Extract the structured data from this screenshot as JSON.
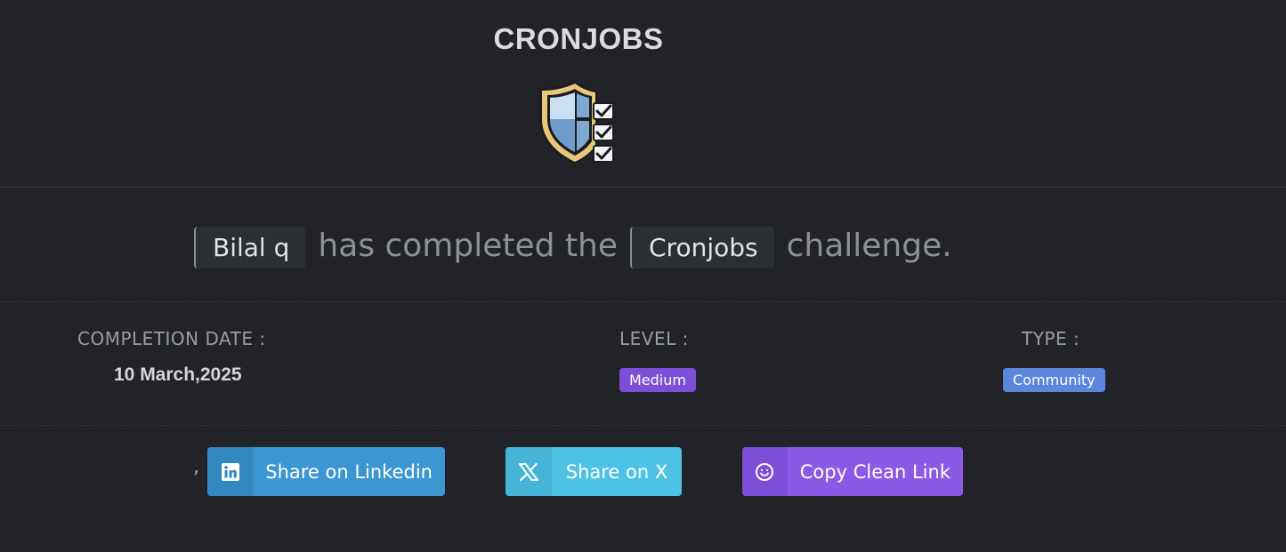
{
  "header": {
    "title": "CRONJOBS",
    "badge_icon": "shield-checklist-icon"
  },
  "statement": {
    "user": "Bilal q",
    "text_middle": "has completed the",
    "challenge": "Cronjobs",
    "text_end": "challenge."
  },
  "meta": {
    "completion_date_label": "COMPLETION DATE :",
    "completion_date_value": "10 March,2025",
    "level_label": "LEVEL :",
    "level_value": "Medium",
    "type_label": "TYPE :",
    "type_value": "Community"
  },
  "share": {
    "separator": ",",
    "linkedin_label": "Share on Linkedin",
    "x_label": "Share on X",
    "copy_label": "Copy Clean Link"
  },
  "colors": {
    "background": "#212328",
    "level_pill": "#7b4fd6",
    "type_pill": "#5b86dc",
    "linkedin": "#3b96d1",
    "x": "#4ec2e4",
    "copy": "#8c59e6"
  }
}
